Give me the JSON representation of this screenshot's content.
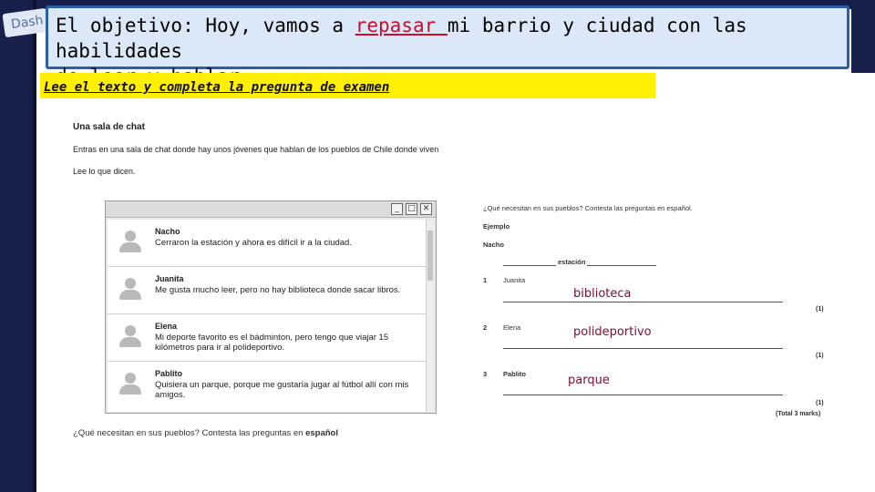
{
  "corner_tag": "Dash",
  "objective": {
    "part1": "El objetivo: Hoy, vamos a ",
    "highlight": "repasar ",
    "part2": "mi barrio y ciudad con las habilidades",
    "line2": "de leer y hablar"
  },
  "banner": "Lee el texto y completa la pregunta de examen",
  "exam": {
    "title": "Una sala de chat",
    "intro": "Entras en una sala de chat donde hay unos jóvenes que hablan de los pueblos de Chile donde viven",
    "read": "Lee lo que dicen."
  },
  "chat": {
    "window_buttons": [
      "_",
      "□",
      "✕"
    ],
    "messages": [
      {
        "name": "Nacho",
        "text": "Cerraron la estación y ahora es difícil ir a la ciudad."
      },
      {
        "name": "Juanita",
        "text": "Me gusta mucho leer, pero no hay biblioteca donde sacar libros."
      },
      {
        "name": "Elena",
        "text": "Mi deporte favorito es el bádminton, pero tengo que viajar 15 kilómetros para ir al polideportivo."
      },
      {
        "name": "Pablito",
        "text": "Quisiera un parque, porque me gustaría jugar al fútbol allí con mis amigos."
      }
    ]
  },
  "questions": {
    "prompt": "¿Qué necesitan en sus pueblos? Contesta las preguntas en español.",
    "ejemplo_label": "Ejemplo",
    "ejemplo_name": "Nacho",
    "ejemplo_answer": "estación",
    "items": [
      {
        "num": "1",
        "name": "Juanita",
        "answer": "biblioteca",
        "marks": "(1)"
      },
      {
        "num": "2",
        "name": "Elena",
        "answer": "polideportivo",
        "marks": "(1)"
      },
      {
        "num": "3",
        "name": "Pablito",
        "answer": "parque",
        "marks": "(1)"
      }
    ],
    "total": "(Total 3 marks)"
  },
  "bottom_question": {
    "text": "¿Qué necesitan en sus pueblos? Contesta las preguntas en ",
    "bold": "español"
  }
}
